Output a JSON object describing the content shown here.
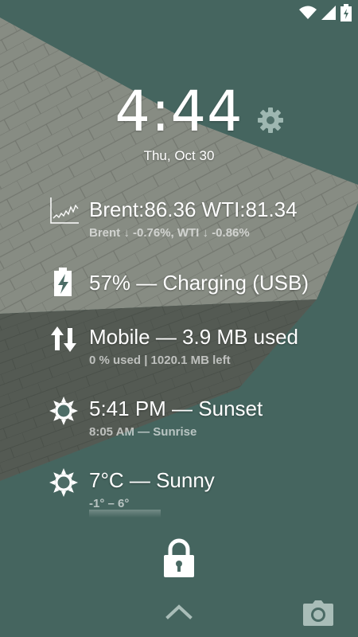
{
  "status_bar": {
    "icons": [
      "wifi-icon",
      "signal-icon",
      "battery-charging-icon"
    ]
  },
  "lockscreen": {
    "time": "4:44",
    "date": "Thu, Oct 30"
  },
  "widgets": [
    {
      "icon": "stock-chart-icon",
      "primary": "Brent:86.36 WTI:81.34",
      "secondary": "Brent ↓ -0.76%, WTI ↓ -0.86%"
    },
    {
      "icon": "battery-charging-icon",
      "primary": "57% — Charging (USB)",
      "secondary": ""
    },
    {
      "icon": "data-transfer-icon",
      "primary": "Mobile — 3.9 MB used",
      "secondary": "0 % used  |  1020.1 MB left"
    },
    {
      "icon": "sun-icon",
      "primary": "5:41 PM — Sunset",
      "secondary": "8:05 AM — Sunrise"
    },
    {
      "icon": "sun-icon",
      "primary": "7°C — Sunny",
      "secondary": "-1° – 6°"
    }
  ],
  "bottom": {
    "icons": [
      "lock-icon",
      "chevron-up-icon",
      "camera-icon"
    ]
  }
}
